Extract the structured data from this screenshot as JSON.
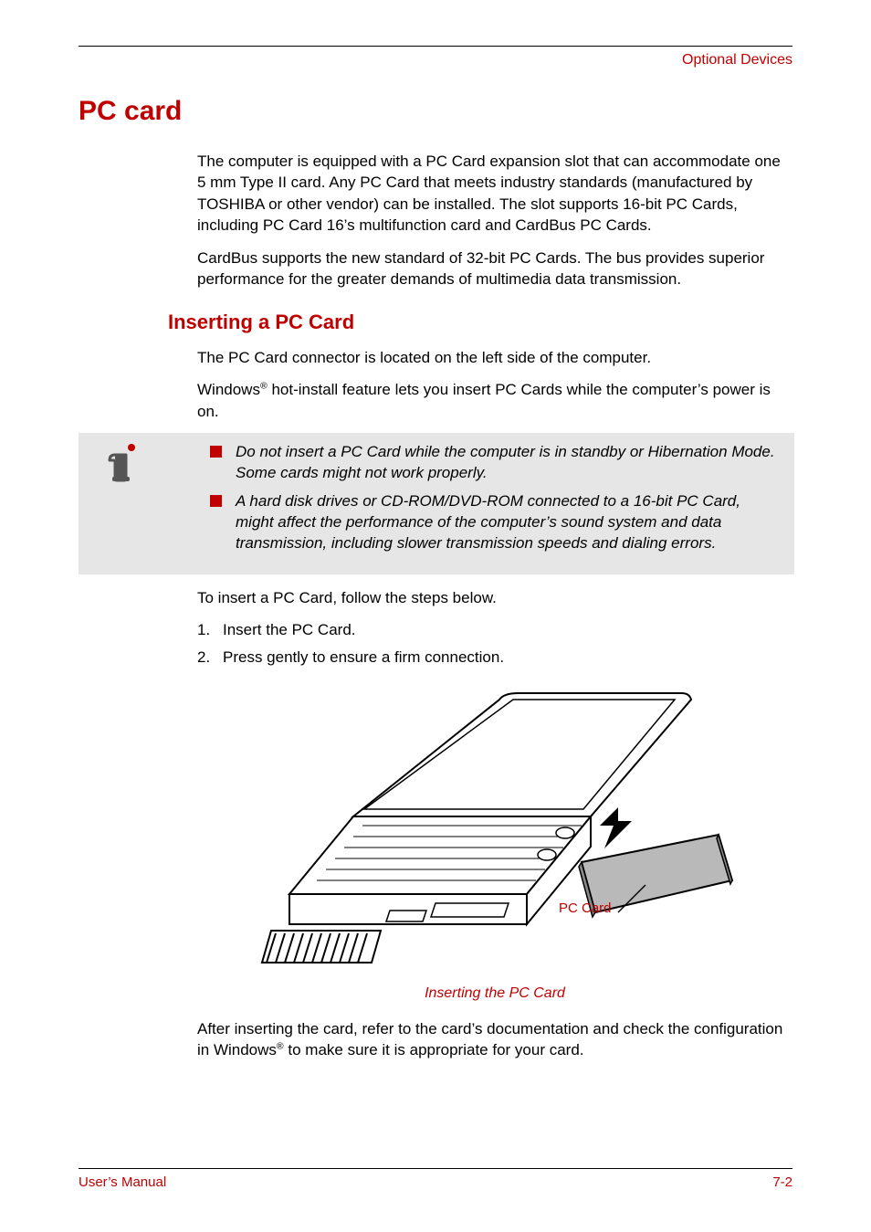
{
  "header": {
    "section": "Optional Devices"
  },
  "h1": "PC card",
  "intro": {
    "p1": "The computer is equipped with a PC Card expansion slot that can accommodate one 5 mm Type II card. Any PC Card that meets industry standards (manufactured by TOSHIBA or other vendor) can be installed. The slot supports 16-bit PC Cards, including PC Card 16’s multifunction card and CardBus PC Cards.",
    "p2": "CardBus supports the new standard of 32-bit PC Cards. The bus provides superior performance for the greater demands of multimedia data transmission."
  },
  "h2": "Inserting a PC Card",
  "insert": {
    "p1": "The PC Card connector is located on the left side of the computer.",
    "p2a": "Windows",
    "p2sup": "®",
    "p2b": " hot-install feature lets you insert PC Cards while the computer’s power is on."
  },
  "notes": {
    "n1": "Do not insert a PC Card while the computer is in standby or Hibernation Mode. Some cards might not work properly.",
    "n2": "A hard disk drives or CD-ROM/DVD-ROM connected to a 16-bit PC Card, might affect the performance of the computer’s sound system and data transmission, including slower transmission speeds and dialing errors."
  },
  "steps_intro": "To insert a PC Card, follow the steps below.",
  "steps": {
    "s1_num": "1.",
    "s1_text": "Insert the PC Card.",
    "s2_num": "2.",
    "s2_text": "Press gently to ensure a firm connection."
  },
  "figure": {
    "label": "PC Card",
    "caption": "Inserting the PC Card"
  },
  "after": {
    "p1a": "After inserting the card, refer to the card’s documentation and check the configuration in Windows",
    "p1sup": "®",
    "p1b": " to make sure it is appropriate for your card."
  },
  "footer": {
    "left": "User’s Manual",
    "right": "7-2"
  },
  "icons": {
    "info": "info-icon"
  }
}
